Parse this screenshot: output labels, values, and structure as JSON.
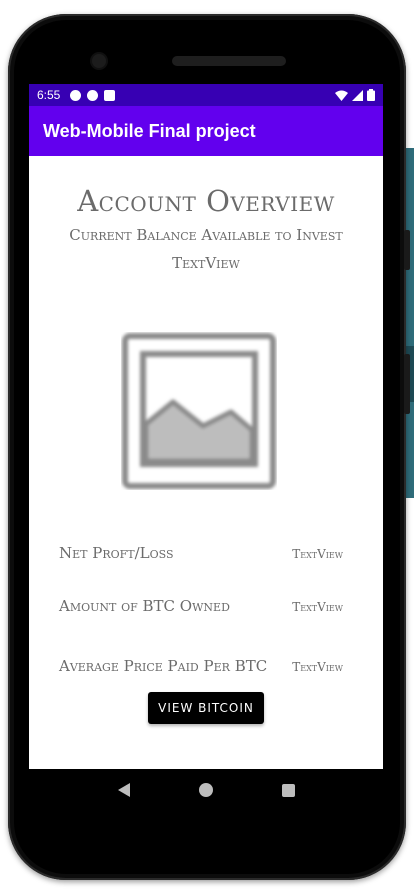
{
  "status_bar": {
    "time": "6:55"
  },
  "app_bar": {
    "title": "Web-Mobile Final project"
  },
  "overview": {
    "title": "Account Overview",
    "subtitle": "Current Balance Available to Invest",
    "balance_value": "TextView"
  },
  "image_placeholder": {
    "icon": "image-placeholder-icon"
  },
  "rows": [
    {
      "label": "Net Proft/Loss",
      "value": "TextView"
    },
    {
      "label": "Amount of BTC Owned",
      "value": "TextView"
    },
    {
      "label": "Average Price Paid Per BTC",
      "value": "TextView"
    }
  ],
  "actions": {
    "view_bitcoin": "VIEW BITCOIN"
  },
  "colors": {
    "status_bar": "#3700b3",
    "app_bar": "#6200ee",
    "button": "#000000",
    "text": "#6b6b6b"
  }
}
